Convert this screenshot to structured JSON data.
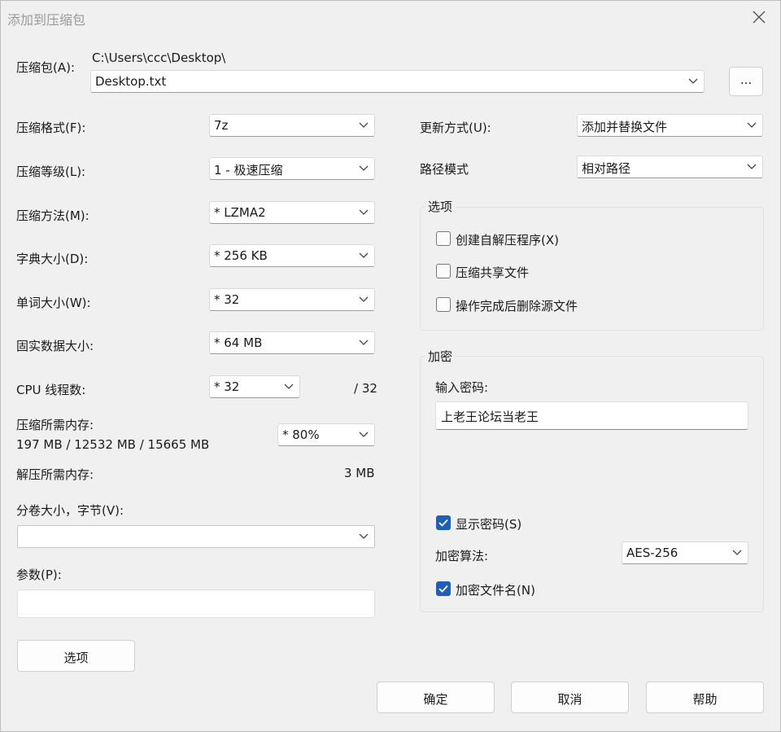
{
  "window": {
    "title": "添加到压缩包"
  },
  "archive": {
    "label": "压缩包(A):",
    "path": "C:\\Users\\ccc\\Desktop\\",
    "name": "Desktop.txt",
    "browse_label": "..."
  },
  "left": {
    "format_label": "压缩格式(F):",
    "format_value": "7z",
    "level_label": "压缩等级(L):",
    "level_value": "1 - 极速压缩",
    "method_label": "压缩方法(M):",
    "method_value": "* LZMA2",
    "dict_label": "字典大小(D):",
    "dict_value": "* 256 KB",
    "word_label": "单词大小(W):",
    "word_value": "* 32",
    "solid_label": "固实数据大小:",
    "solid_value": "* 64 MB",
    "cpu_label": "CPU 线程数:",
    "cpu_value": "* 32",
    "cpu_max": "/ 32",
    "mem_label": "压缩所需内存:",
    "mem_detail": "197 MB / 12532 MB / 15665 MB",
    "mem_value": "* 80%",
    "decomp_label": "解压所需内存:",
    "decomp_value": "3 MB",
    "volume_label": "分卷大小，字节(V):",
    "volume_value": "",
    "params_label": "参数(P):",
    "params_value": "",
    "options_button": "选项"
  },
  "right": {
    "update_label": "更新方式(U):",
    "update_value": "添加并替换文件",
    "path_label": "路径模式",
    "path_value": "相对路径",
    "options_group": "选项",
    "opt_sfx": "创建自解压程序(X)",
    "opt_shared": "压缩共享文件",
    "opt_delete": "操作完成后删除源文件",
    "encrypt_group": "加密",
    "password_label": "输入密码:",
    "password_value": "上老王论坛当老王",
    "show_password": "显示密码(S)",
    "algo_label": "加密算法:",
    "algo_value": "AES-256",
    "encrypt_names": "加密文件名(N)"
  },
  "footer": {
    "ok": "确定",
    "cancel": "取消",
    "help": "帮助"
  }
}
